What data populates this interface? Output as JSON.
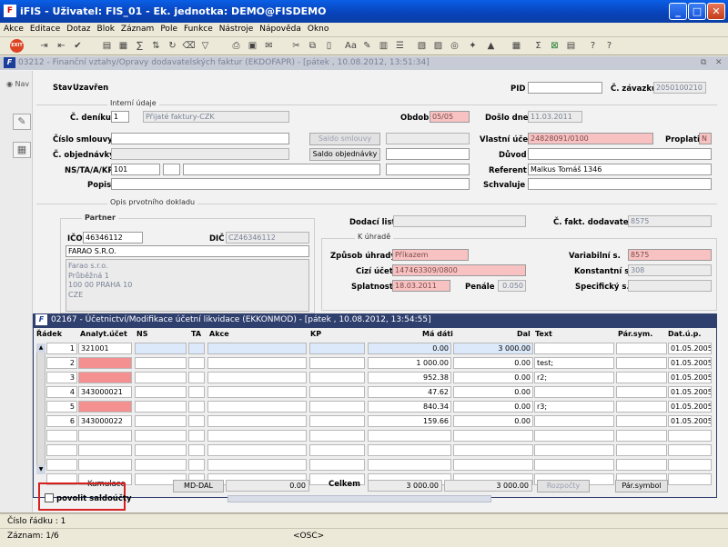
{
  "app": {
    "title": "iFIS - Uživatel: FIS_01 - Ek. jednotka: DEMO@FISDEMO",
    "logo": "F"
  },
  "menu": [
    "Akce",
    "Editace",
    "Dotaz",
    "Blok",
    "Záznam",
    "Pole",
    "Funkce",
    "Nástroje",
    "Nápověda",
    "Okno"
  ],
  "toolbar": {
    "exit_label": "EXIT"
  },
  "form": {
    "title": "03212 - Finanční vztahy/Opravy dodavatelských faktur (EKDOFAPR) - [pátek , 10.08.2012, 13:51:34]",
    "nav_label": "Nav",
    "stav_label": "Stav",
    "stav_value": "Uzavřen",
    "pid_label": "PID",
    "pid_value": "",
    "cislo_zavazku_label": "Č. závazku",
    "cislo_zavazku_value": "2050100210",
    "interni_udaje": "Interní údaje",
    "cislo_deniku_label": "Č. deníku",
    "cislo_deniku_value": "1",
    "denik_name": "Přijaté faktury-CZK",
    "obdobi_label": "Období",
    "obdobi_value": "05/05",
    "doslo_dne_label": "Došlo dne",
    "doslo_dne_value": "11.03.2011",
    "cislo_smlouvy_label": "Číslo smlouvy",
    "saldo_smlouvy": "Saldo smlouvy",
    "vlastni_ucet_label": "Vlastní účet",
    "vlastni_ucet_value": "24828091/0100",
    "proplatit_label": "Proplatit",
    "proplatit_value": "N",
    "cislo_objednavky_label": "Č. objednávky",
    "saldo_objednavky": "Saldo objednávky",
    "duvod_label": "Důvod",
    "ns_label": "NS/TA/A/KP",
    "ns_value": "101",
    "referent_label": "Referent",
    "referent_value": "Malkus Tomáš 1346",
    "popis_label": "Popis",
    "schvaluje_label": "Schvaluje",
    "opis_label": "Opis prvotního dokladu",
    "partner_label": "Partner",
    "ico_label": "IČO",
    "ico_value": "46346112",
    "dic_label": "DIČ",
    "dic_value": "CZ46346112",
    "partner_name": "FARAO S.R.O.",
    "address": [
      "Farao s.r.o.",
      "Průběžná 1",
      "100 00 PRAHA 10",
      "CZE"
    ],
    "dodaci_list_label": "Dodací list",
    "cislo_fakt_label": "Č. fakt. dodavatele",
    "cislo_fakt_value": "8575",
    "k_uhrade_label": "K úhradě",
    "zpusob_uhrady_label": "Způsob úhrady",
    "zpusob_uhrady_value": "Příkazem",
    "variabilni_label": "Variabilní s.",
    "variabilni_value": "8575",
    "cizi_ucet_label": "Cizí účet",
    "cizi_ucet_value": "147463309/0800",
    "konstantni_label": "Konstantní s.",
    "konstantni_value": "308",
    "splatnost_label": "Splatnost",
    "splatnost_value": "18.03.2011",
    "penale_label": "Penále",
    "penale_value": "0.050",
    "specificky_label": "Specifický s."
  },
  "subform": {
    "title": "02167 - Účetnictví/Modifikace účetní likvidace (EKKONMOD) - [pátek , 10.08.2012, 13:54:55]",
    "headers": {
      "radek": "Řádek",
      "analyt": "Analyt.účet",
      "ns": "NS",
      "ta": "TA",
      "akce": "Akce",
      "kp": "KP",
      "ma_dati": "Má dáti",
      "dal": "Dal",
      "text": "Text",
      "par_sym": "Pár.sym.",
      "dat_up": "Dat.ú.p."
    },
    "rows": [
      {
        "radek": "1",
        "ucet": "321001",
        "ma_dati": "0.00",
        "dal": "3 000.00",
        "text": "",
        "dat": "01.05.2005"
      },
      {
        "radek": "2",
        "ucet": "",
        "ma_dati": "1 000.00",
        "dal": "0.00",
        "text": "test;",
        "dat": "01.05.2005"
      },
      {
        "radek": "3",
        "ucet": "",
        "ma_dati": "952.38",
        "dal": "0.00",
        "text": "r2;",
        "dat": "01.05.2005"
      },
      {
        "radek": "4",
        "ucet": "343000021",
        "ma_dati": "47.62",
        "dal": "0.00",
        "text": "",
        "dat": "01.05.2005"
      },
      {
        "radek": "5",
        "ucet": "",
        "ma_dati": "840.34",
        "dal": "0.00",
        "text": "r3;",
        "dat": "01.05.2005"
      },
      {
        "radek": "6",
        "ucet": "343000022",
        "ma_dati": "159.66",
        "dal": "0.00",
        "text": "",
        "dat": "01.05.2005"
      }
    ],
    "kumulace_label": "Kumulace",
    "md_dal_button": "MD-DAL",
    "kumulace_value": "0.00",
    "celkem_label": "Celkem",
    "celkem_ma_dati": "3 000.00",
    "celkem_dal": "3 000.00",
    "rozpocty_button": "Rozpočty",
    "par_symbol_button": "Pár.symbol",
    "povolit_label": "povolit saldoúčty"
  },
  "status": {
    "line1": "Číslo řádku : 1",
    "line2": "Záznam: 1/6",
    "osc": "<OSC>"
  },
  "colors": {
    "titlebar": "#0842b8",
    "required": "#f8c2c2",
    "error": "#f59090",
    "subform_title": "#2f3f6e"
  }
}
